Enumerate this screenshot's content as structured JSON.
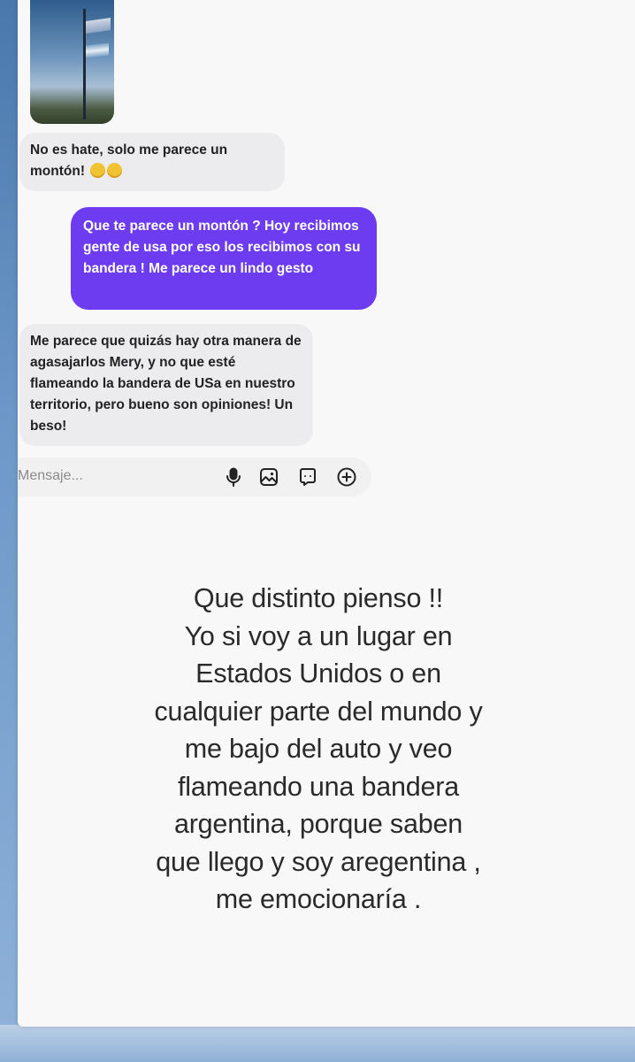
{
  "chat": {
    "messages": [
      {
        "direction": "incoming",
        "text": "No es hate, solo me parece un montón!"
      },
      {
        "direction": "outgoing",
        "text": "Que te parece un montón ? Hoy recibimos gente de usa por eso los recibimos con su bandera ! Me parece un lindo gesto"
      },
      {
        "direction": "incoming",
        "text": "Me parece que quizás hay otra manera de agasajarlos Mery, y no que esté flameando la bandera de USa en nuestro territorio, pero bueno son opiniones! Un beso!"
      }
    ],
    "composer": {
      "placeholder": "Mensaje...",
      "icons": [
        "microphone-icon",
        "image-icon",
        "sticker-icon",
        "add-icon"
      ]
    }
  },
  "story_caption": {
    "lines": [
      "Que distinto pienso !!",
      "Yo si voy a un lugar en",
      "Estados Unidos o en",
      "cualquier parte del mundo y",
      "me bajo del auto y veo",
      "flameando una bandera",
      "argentina, porque saben",
      "que llego y soy aregentina ,",
      "me emocionaría ."
    ]
  },
  "colors": {
    "outgoing_bubble": "#6d3cf0",
    "incoming_bubble": "#ececee",
    "card_background": "#f8f8f8"
  }
}
